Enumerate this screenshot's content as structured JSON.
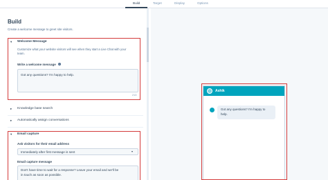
{
  "tabs": [
    {
      "label": "Build",
      "active": true
    },
    {
      "label": "Target",
      "active": false
    },
    {
      "label": "Display",
      "active": false
    },
    {
      "label": "Options",
      "active": false
    }
  ],
  "build": {
    "title": "Build",
    "subtitle": "Create a welcome message to greet site visitors."
  },
  "welcome": {
    "title": "Welcome Message",
    "desc_line1": "Customize what your website visitors will see when they start a Live Chat with your",
    "desc_line2": "team.",
    "field_label": "Write a welcome message",
    "value": "Got any questions? I'm happy to help.",
    "counter": "213"
  },
  "knowledge": {
    "title": "Knowledge base search"
  },
  "assign": {
    "title": "Automatically assign conversations"
  },
  "email": {
    "title": "Email capture",
    "ask_label": "Ask visitors for their email address",
    "ask_value": "Immediately after first message is sent",
    "msg_label": "Email capture message",
    "msg_line1": "Don't have time to wait for a response? Leave your email and we'll be",
    "msg_line2": "in touch as soon as possible."
  },
  "preview": {
    "name": "Ashik",
    "bubble_line1": "Got any questions? I'm happy to",
    "bubble_line2": "help."
  },
  "colors": {
    "accent": "#00a4bd",
    "annotation": "#d43a3a"
  }
}
